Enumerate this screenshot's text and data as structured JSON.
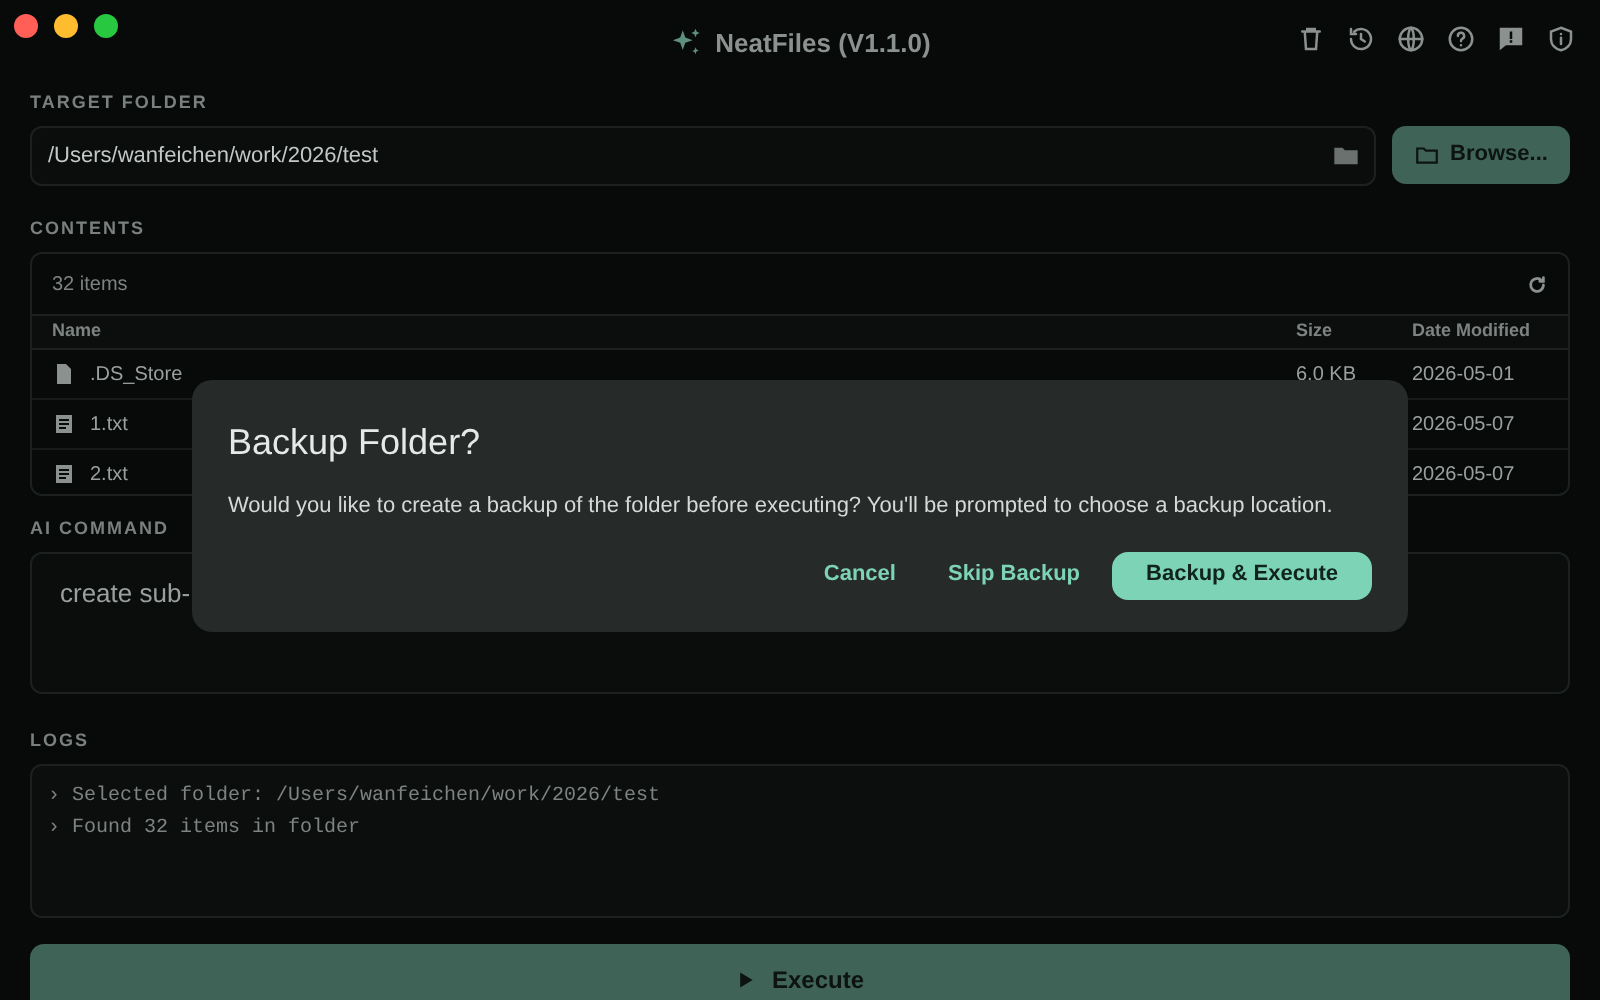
{
  "window": {
    "title": "NeatFiles (V1.1.0)"
  },
  "target_folder": {
    "label": "TARGET FOLDER",
    "path": "/Users/wanfeichen/work/2026/test",
    "browse_button": "Browse..."
  },
  "contents": {
    "label": "CONTENTS",
    "count": "32 items",
    "columns": [
      "Name",
      "Size",
      "Date Modified"
    ],
    "rows": [
      {
        "kind": "generic",
        "name": ".DS_Store",
        "size": "6.0 KB",
        "date": "2026-05-01"
      },
      {
        "kind": "text",
        "name": "1.txt",
        "date": "2026-05-07"
      },
      {
        "kind": "text",
        "name": "2.txt",
        "date": "2026-05-07"
      }
    ]
  },
  "ai_command": {
    "label": "AI COMMAND",
    "value": "create sub-"
  },
  "logs": {
    "label": "LOGS",
    "lines": [
      "› Selected folder: /Users/wanfeichen/work/2026/test",
      "› Found 32 items in folder"
    ]
  },
  "execute_button": "Execute",
  "dialog": {
    "title": "Backup Folder?",
    "message": "Would you like to create a backup of the folder before executing? You'll be prompted to choose a backup location.",
    "buttons": [
      {
        "label": "Cancel",
        "kind": "text"
      },
      {
        "label": "Skip Backup",
        "kind": "text"
      },
      {
        "label": "Backup & Execute",
        "kind": "primary"
      }
    ]
  }
}
